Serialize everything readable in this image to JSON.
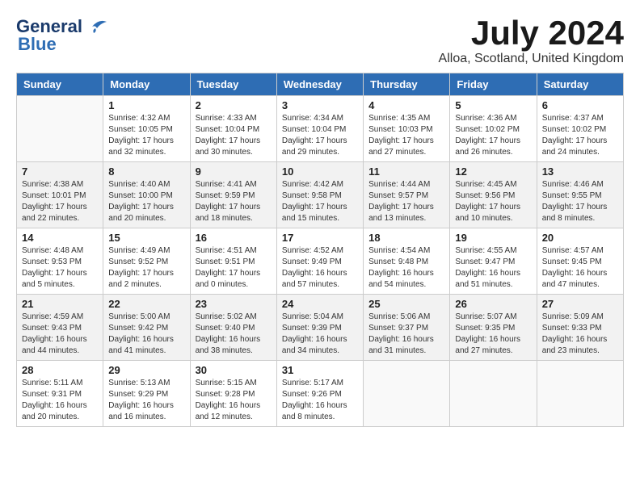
{
  "header": {
    "logo_line1": "General",
    "logo_line2": "Blue",
    "month_title": "July 2024",
    "location": "Alloa, Scotland, United Kingdom"
  },
  "days_of_week": [
    "Sunday",
    "Monday",
    "Tuesday",
    "Wednesday",
    "Thursday",
    "Friday",
    "Saturday"
  ],
  "weeks": [
    [
      {
        "day": "",
        "info": ""
      },
      {
        "day": "1",
        "info": "Sunrise: 4:32 AM\nSunset: 10:05 PM\nDaylight: 17 hours\nand 32 minutes."
      },
      {
        "day": "2",
        "info": "Sunrise: 4:33 AM\nSunset: 10:04 PM\nDaylight: 17 hours\nand 30 minutes."
      },
      {
        "day": "3",
        "info": "Sunrise: 4:34 AM\nSunset: 10:04 PM\nDaylight: 17 hours\nand 29 minutes."
      },
      {
        "day": "4",
        "info": "Sunrise: 4:35 AM\nSunset: 10:03 PM\nDaylight: 17 hours\nand 27 minutes."
      },
      {
        "day": "5",
        "info": "Sunrise: 4:36 AM\nSunset: 10:02 PM\nDaylight: 17 hours\nand 26 minutes."
      },
      {
        "day": "6",
        "info": "Sunrise: 4:37 AM\nSunset: 10:02 PM\nDaylight: 17 hours\nand 24 minutes."
      }
    ],
    [
      {
        "day": "7",
        "info": "Sunrise: 4:38 AM\nSunset: 10:01 PM\nDaylight: 17 hours\nand 22 minutes."
      },
      {
        "day": "8",
        "info": "Sunrise: 4:40 AM\nSunset: 10:00 PM\nDaylight: 17 hours\nand 20 minutes."
      },
      {
        "day": "9",
        "info": "Sunrise: 4:41 AM\nSunset: 9:59 PM\nDaylight: 17 hours\nand 18 minutes."
      },
      {
        "day": "10",
        "info": "Sunrise: 4:42 AM\nSunset: 9:58 PM\nDaylight: 17 hours\nand 15 minutes."
      },
      {
        "day": "11",
        "info": "Sunrise: 4:44 AM\nSunset: 9:57 PM\nDaylight: 17 hours\nand 13 minutes."
      },
      {
        "day": "12",
        "info": "Sunrise: 4:45 AM\nSunset: 9:56 PM\nDaylight: 17 hours\nand 10 minutes."
      },
      {
        "day": "13",
        "info": "Sunrise: 4:46 AM\nSunset: 9:55 PM\nDaylight: 17 hours\nand 8 minutes."
      }
    ],
    [
      {
        "day": "14",
        "info": "Sunrise: 4:48 AM\nSunset: 9:53 PM\nDaylight: 17 hours\nand 5 minutes."
      },
      {
        "day": "15",
        "info": "Sunrise: 4:49 AM\nSunset: 9:52 PM\nDaylight: 17 hours\nand 2 minutes."
      },
      {
        "day": "16",
        "info": "Sunrise: 4:51 AM\nSunset: 9:51 PM\nDaylight: 17 hours\nand 0 minutes."
      },
      {
        "day": "17",
        "info": "Sunrise: 4:52 AM\nSunset: 9:49 PM\nDaylight: 16 hours\nand 57 minutes."
      },
      {
        "day": "18",
        "info": "Sunrise: 4:54 AM\nSunset: 9:48 PM\nDaylight: 16 hours\nand 54 minutes."
      },
      {
        "day": "19",
        "info": "Sunrise: 4:55 AM\nSunset: 9:47 PM\nDaylight: 16 hours\nand 51 minutes."
      },
      {
        "day": "20",
        "info": "Sunrise: 4:57 AM\nSunset: 9:45 PM\nDaylight: 16 hours\nand 47 minutes."
      }
    ],
    [
      {
        "day": "21",
        "info": "Sunrise: 4:59 AM\nSunset: 9:43 PM\nDaylight: 16 hours\nand 44 minutes."
      },
      {
        "day": "22",
        "info": "Sunrise: 5:00 AM\nSunset: 9:42 PM\nDaylight: 16 hours\nand 41 minutes."
      },
      {
        "day": "23",
        "info": "Sunrise: 5:02 AM\nSunset: 9:40 PM\nDaylight: 16 hours\nand 38 minutes."
      },
      {
        "day": "24",
        "info": "Sunrise: 5:04 AM\nSunset: 9:39 PM\nDaylight: 16 hours\nand 34 minutes."
      },
      {
        "day": "25",
        "info": "Sunrise: 5:06 AM\nSunset: 9:37 PM\nDaylight: 16 hours\nand 31 minutes."
      },
      {
        "day": "26",
        "info": "Sunrise: 5:07 AM\nSunset: 9:35 PM\nDaylight: 16 hours\nand 27 minutes."
      },
      {
        "day": "27",
        "info": "Sunrise: 5:09 AM\nSunset: 9:33 PM\nDaylight: 16 hours\nand 23 minutes."
      }
    ],
    [
      {
        "day": "28",
        "info": "Sunrise: 5:11 AM\nSunset: 9:31 PM\nDaylight: 16 hours\nand 20 minutes."
      },
      {
        "day": "29",
        "info": "Sunrise: 5:13 AM\nSunset: 9:29 PM\nDaylight: 16 hours\nand 16 minutes."
      },
      {
        "day": "30",
        "info": "Sunrise: 5:15 AM\nSunset: 9:28 PM\nDaylight: 16 hours\nand 12 minutes."
      },
      {
        "day": "31",
        "info": "Sunrise: 5:17 AM\nSunset: 9:26 PM\nDaylight: 16 hours\nand 8 minutes."
      },
      {
        "day": "",
        "info": ""
      },
      {
        "day": "",
        "info": ""
      },
      {
        "day": "",
        "info": ""
      }
    ]
  ]
}
